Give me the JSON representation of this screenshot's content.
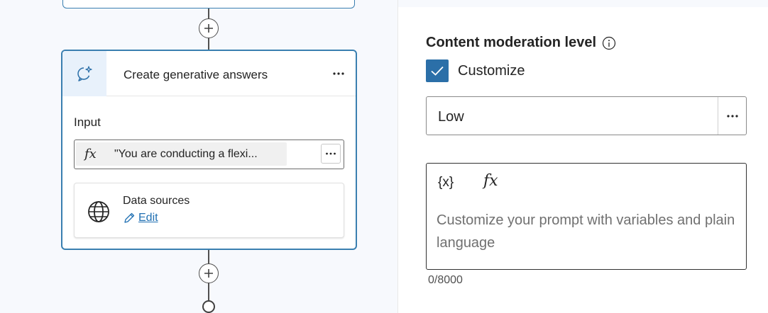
{
  "canvas": {
    "node": {
      "title": "Create generative answers",
      "more_label": "···",
      "input_label": "Input",
      "formula_symbol": "fx",
      "formula_text": "\"You are conducting a flexi...",
      "input_more_label": "···",
      "data_sources_title": "Data sources",
      "edit_label": "Edit"
    },
    "icons": {
      "node_icon": "sparkle-chat-icon",
      "add": "plus-icon",
      "globe": "globe-icon",
      "pencil": "pencil-icon",
      "end": "end-circle-icon"
    }
  },
  "panel": {
    "content_moderation_title": "Content moderation level",
    "info_icon": "info-icon",
    "customize_label": "Customize",
    "customize_checked": true,
    "select_value": "Low",
    "select_more_label": "···",
    "variable_button": "{x}",
    "formula_button": "fx",
    "prompt_placeholder": "Customize your prompt with variables and plain language",
    "char_counter": "0/8000"
  },
  "colors": {
    "accent": "#3a7fb0",
    "checkbox": "#2b6fa8",
    "link": "#1f6fb2",
    "canvas_bg": "#f7f9fd"
  }
}
